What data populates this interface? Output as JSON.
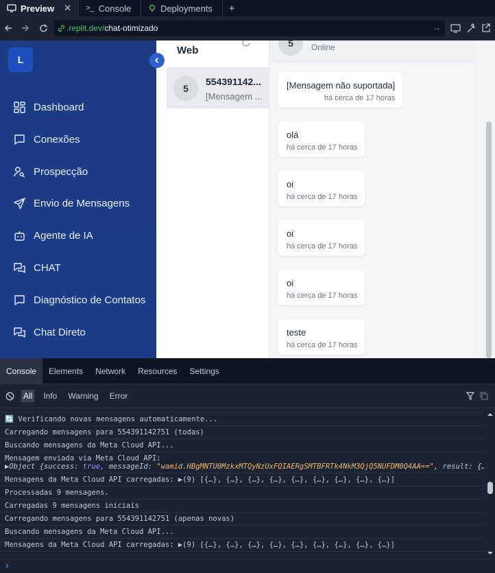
{
  "browser": {
    "tabs": [
      {
        "label": "Preview",
        "icon": "monitor-icon"
      },
      {
        "label": "Console",
        "icon": "terminal-icon"
      },
      {
        "label": "Deployments",
        "icon": "deploy-icon"
      }
    ],
    "url_prefix": ".replit.dev/",
    "url_path": "chat-otimizado"
  },
  "sidebar": {
    "logo_letter": "L",
    "items": [
      {
        "label": "Dashboard",
        "icon": "dashboard-icon"
      },
      {
        "label": "Conexões",
        "icon": "chat-bubble-icon"
      },
      {
        "label": "Prospecção",
        "icon": "user-search-icon"
      },
      {
        "label": "Envio de Mensagens",
        "icon": "send-icon"
      },
      {
        "label": "Agente de IA",
        "icon": "bot-icon"
      },
      {
        "label": "CHAT",
        "icon": "chats-icon"
      },
      {
        "label": "Diagnóstico de Contatos",
        "icon": "chat-bubble-icon"
      },
      {
        "label": "Chat Direto",
        "icon": "chats-icon"
      }
    ]
  },
  "chat_list": {
    "title": "Web",
    "items": [
      {
        "avatar": "5",
        "name": "554391142...",
        "last": "[Mensagem ..."
      }
    ]
  },
  "conversation": {
    "avatar": "5",
    "status": "Online",
    "messages": [
      {
        "text": "[Mensagem não suportada]",
        "time": "há cerca de 17 horas"
      },
      {
        "text": "olá",
        "time": "há cerca de 17 horas"
      },
      {
        "text": "oi",
        "time": "há cerca de 17 horas"
      },
      {
        "text": "oi",
        "time": "há cerca de 17 horas"
      },
      {
        "text": "oi",
        "time": "há cerca de 17 horas"
      },
      {
        "text": "teste",
        "time": "há cerca de 17 horas"
      }
    ]
  },
  "devtools": {
    "tabs": [
      "Console",
      "Elements",
      "Network",
      "Resources",
      "Settings"
    ],
    "filters": [
      "All",
      "Info",
      "Warning",
      "Error"
    ],
    "logs": [
      "🔄 Verificando novas mensagens automaticamente...",
      "Carregando mensagens para 554391142751 (todas)",
      "Buscando mensagens da Meta Cloud API...",
      "Mensagem enviada via Meta Cloud API:",
      "Mensagens da Meta Cloud API carregadas: ▶(9) [{…}, {…}, {…}, {…}, {…}, {…}, {…}, {…}, {…}]",
      "Processadas 9 mensagens.",
      "Carregadas 9 mensagens iniciais",
      "Carregando mensagens para 554391142751 (apenas novas)",
      "Buscando mensagens da Meta Cloud API...",
      "Mensagens da Meta Cloud API carregadas: ▶(9) [{…}, {…}, {…}, {…}, {…}, {…}, {…}, {…}, {…}]"
    ],
    "object_line": {
      "prefix": "▶Object {success: ",
      "true_kw": "true",
      "mid": ", messageId: ",
      "id": "\"wamid.HBgMNTU0MzkxMTQyNzUxFQIAERgSMTBFRTk4NkM3QjQ5NUFDM0Q4AA==\"",
      "suffix": ", result: {…}}"
    },
    "prompt": "›"
  }
}
